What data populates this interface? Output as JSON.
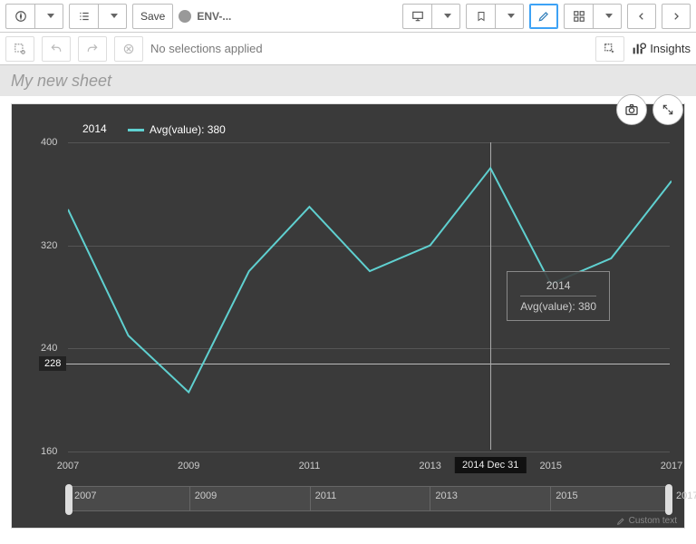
{
  "toolbar": {
    "save_label": "Save",
    "app_label": "ENV-..."
  },
  "selbar": {
    "text": "No selections applied",
    "insights_label": "Insights"
  },
  "sheet": {
    "title": "My new sheet"
  },
  "legend": {
    "year": "2014",
    "measure": "Avg(value): 380"
  },
  "tooltip": {
    "year": "2014",
    "measure": "Avg(value): 380"
  },
  "hover_x": "2014 Dec 31",
  "reference_label": "228",
  "footer": "Custom text",
  "y_ticks": [
    "400",
    "320",
    "240",
    "160"
  ],
  "x_ticks": [
    "2007",
    "2009",
    "2011",
    "2013",
    "2015",
    "2017"
  ],
  "mini_ticks": [
    "2007",
    "2009",
    "2011",
    "2013",
    "2015",
    "2017"
  ],
  "chart_data": {
    "type": "line",
    "title": "",
    "xlabel": "",
    "ylabel": "",
    "ylim": [
      160,
      400
    ],
    "series": [
      {
        "name": "Avg(value)",
        "color": "#5fd0d0",
        "x": [
          2007,
          2008,
          2009,
          2010,
          2011,
          2012,
          2013,
          2014,
          2015,
          2016,
          2017
        ],
        "y": [
          348,
          250,
          206,
          300,
          350,
          300,
          320,
          380,
          290,
          310,
          370
        ]
      }
    ],
    "reference_lines": [
      {
        "value": 228,
        "label": "228"
      }
    ],
    "highlight_x": 2014,
    "highlight_label": "2014 Dec 31",
    "range_slider": {
      "min": 2007,
      "max": 2017,
      "ticks": [
        2007,
        2009,
        2011,
        2013,
        2015,
        2017
      ]
    }
  }
}
